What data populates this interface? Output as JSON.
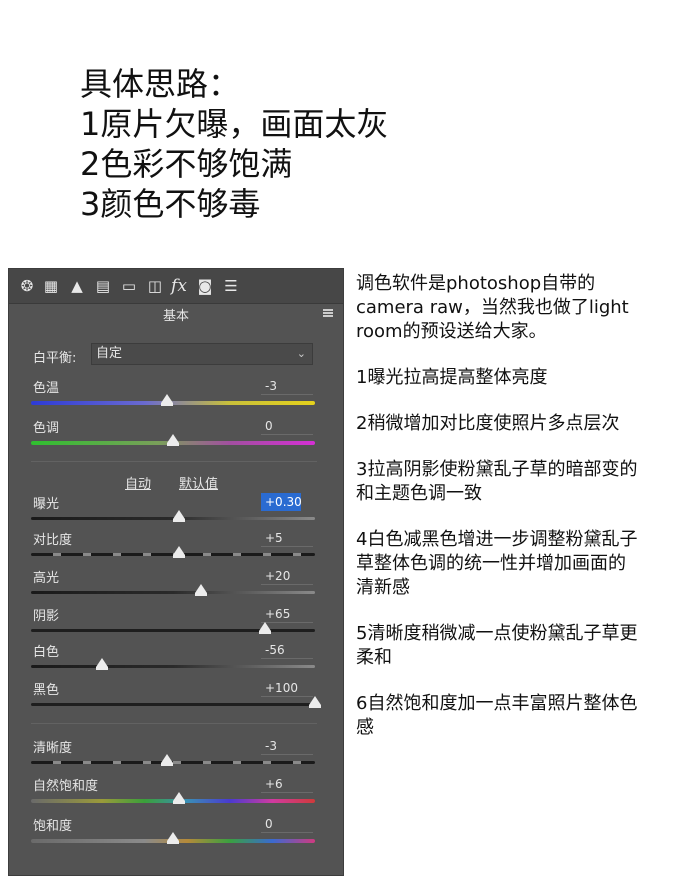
{
  "headline": [
    "具体思路：",
    "1原片欠曝，画面太灰",
    "2色彩不够饱满",
    "3颜色不够毒"
  ],
  "panel": {
    "section_title": "基本",
    "white_balance": {
      "label": "白平衡:",
      "value": "自定"
    },
    "auto_label": "自动",
    "default_label": "默认值",
    "sliders": [
      {
        "label": "色温",
        "value": "-3",
        "position": 0.48
      },
      {
        "label": "色调",
        "value": "0",
        "position": 0.5
      },
      {
        "label": "曝光",
        "value": "+0.30",
        "position": 0.52
      },
      {
        "label": "对比度",
        "value": "+5",
        "position": 0.52
      },
      {
        "label": "高光",
        "value": "+20",
        "position": 0.6
      },
      {
        "label": "阴影",
        "value": "+65",
        "position": 0.825
      },
      {
        "label": "白色",
        "value": "-56",
        "position": 0.25
      },
      {
        "label": "黑色",
        "value": "+100",
        "position": 1.0
      },
      {
        "label": "清晰度",
        "value": "-3",
        "position": 0.48
      },
      {
        "label": "自然饱和度",
        "value": "+6",
        "position": 0.52
      },
      {
        "label": "饱和度",
        "value": "0",
        "position": 0.5
      }
    ]
  },
  "notes": [
    "调色软件是photoshop自带的\ncamera raw，当然我也做了light\nroom的预设送给大家。",
    "1曝光拉高提高整体亮度",
    "2稍微增加对比度使照片多点层次",
    "3拉高阴影使粉黛乱子草的暗部变的\n和主题色调一致",
    "4白色减黑色增进一步调整粉黛乱子\n草整体色调的统一性并增加画面的\n清新感",
    "5清晰度稍微减一点使粉黛乱子草更\n柔和",
    "6自然饱和度加一点丰富照片整体色\n感"
  ]
}
